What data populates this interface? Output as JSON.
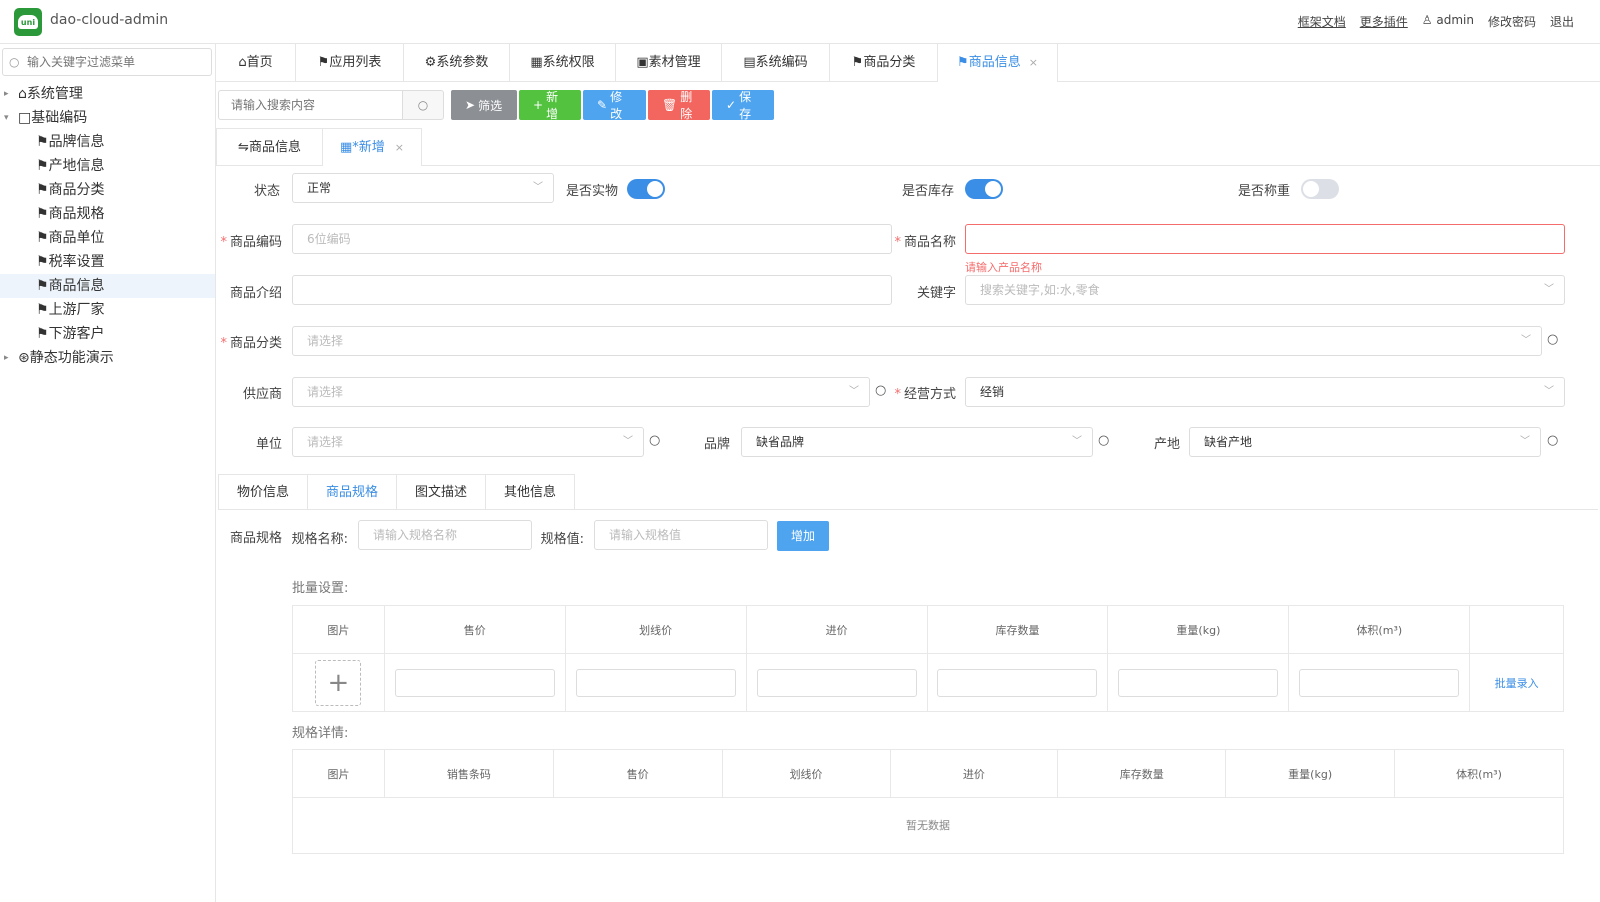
{
  "header": {
    "logo_text": "uni",
    "app_title": "dao-cloud-admin",
    "links": {
      "docs": "框架文档",
      "plugins": "更多插件",
      "user": "admin",
      "change_password": "修改密码",
      "logout": "退出"
    }
  },
  "sidebar": {
    "search_placeholder": "输入关键字过滤菜单",
    "items": [
      {
        "label": "系统管理",
        "icon": "home-icon"
      },
      {
        "label": "基础编码",
        "icon": "box-icon"
      },
      {
        "label": "品牌信息",
        "icon": "flag-icon"
      },
      {
        "label": "产地信息",
        "icon": "flag-icon"
      },
      {
        "label": "商品分类",
        "icon": "flag-icon"
      },
      {
        "label": "商品规格",
        "icon": "flag-icon"
      },
      {
        "label": "商品单位",
        "icon": "flag-icon"
      },
      {
        "label": "税率设置",
        "icon": "flag-icon"
      },
      {
        "label": "商品信息",
        "icon": "flag-icon"
      },
      {
        "label": "上游厂家",
        "icon": "flag-icon"
      },
      {
        "label": "下游客户",
        "icon": "flag-icon"
      },
      {
        "label": "静态功能演示",
        "icon": "settings-icon"
      }
    ]
  },
  "page_tabs": [
    {
      "label": "首页"
    },
    {
      "label": "应用列表"
    },
    {
      "label": "系统参数"
    },
    {
      "label": "系统权限"
    },
    {
      "label": "素材管理"
    },
    {
      "label": "系统编码"
    },
    {
      "label": "商品分类"
    },
    {
      "label": "商品信息"
    }
  ],
  "toolbar": {
    "search_placeholder": "请输入搜索内容",
    "filter": "筛选",
    "add": "新增",
    "edit": "修改",
    "delete": "删除",
    "save": "保存"
  },
  "sub_tabs": {
    "list": "商品信息",
    "new": "*新增"
  },
  "form": {
    "status_label": "状态",
    "status_value": "正常",
    "is_physical_label": "是否实物",
    "is_inventory_label": "是否库存",
    "is_weighed_label": "是否称重",
    "code_label": "商品编码",
    "code_placeholder": "6位编码",
    "name_label": "商品名称",
    "name_error": "请输入产品名称",
    "intro_label": "商品介绍",
    "keyword_label": "关键字",
    "keyword_placeholder": "搜索关键字,如:水,零食",
    "category_label": "商品分类",
    "category_placeholder": "请选择",
    "supplier_label": "供应商",
    "supplier_placeholder": "请选择",
    "mode_label": "经营方式",
    "mode_value": "经销",
    "unit_label": "单位",
    "unit_placeholder": "请选择",
    "brand_label": "品牌",
    "brand_value": "缺省品牌",
    "origin_label": "产地",
    "origin_value": "缺省产地"
  },
  "inner_tabs": [
    "物价信息",
    "商品规格",
    "图文描述",
    "其他信息"
  ],
  "spec": {
    "section_label": "商品规格",
    "name_label": "规格名称:",
    "name_placeholder": "请输入规格名称",
    "value_label": "规格值:",
    "value_placeholder": "请输入规格值",
    "add_button": "增加",
    "batch_title": "批量设置:",
    "batch_columns": [
      "图片",
      "售价",
      "划线价",
      "进价",
      "库存数量",
      "重量(kg)",
      "体积(m³)",
      ""
    ],
    "batch_link": "批量录入",
    "detail_title": "规格详情:",
    "detail_columns": [
      "图片",
      "销售条码",
      "售价",
      "划线价",
      "进价",
      "库存数量",
      "重量(kg)",
      "体积(m³)"
    ],
    "empty_text": "暂无数据"
  }
}
